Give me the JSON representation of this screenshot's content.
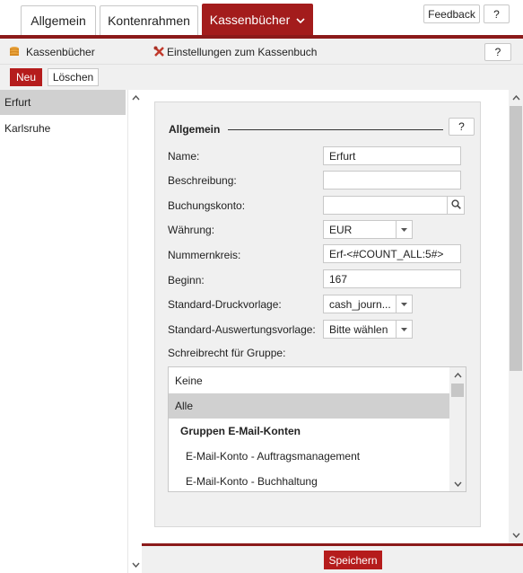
{
  "tabs": [
    {
      "label": "Allgemein"
    },
    {
      "label": "Kontenrahmen"
    },
    {
      "label": "Kassenbücher"
    }
  ],
  "top_buttons": {
    "feedback": "Feedback",
    "help": "?"
  },
  "left_header": {
    "title": "Kassenbücher"
  },
  "right_header": {
    "title": "Einstellungen zum Kassenbuch",
    "help": "?"
  },
  "left_toolbar": {
    "new": "Neu",
    "delete": "Löschen"
  },
  "cashbooks": [
    {
      "label": "Erfurt",
      "selected": true
    },
    {
      "label": "Karlsruhe",
      "selected": false
    }
  ],
  "form": {
    "section_title": "Allgemein",
    "section_help": "?",
    "name": {
      "label": "Name:",
      "value": "Erfurt"
    },
    "description": {
      "label": "Beschreibung:",
      "value": ""
    },
    "account": {
      "label": "Buchungskonto:",
      "value": ""
    },
    "currency": {
      "label": "Währung:",
      "value": "EUR"
    },
    "number_range": {
      "label": "Nummernkreis:",
      "value": "Erf-<#COUNT_ALL:5#>"
    },
    "start": {
      "label": "Beginn:",
      "value": "167"
    },
    "print_template": {
      "label": "Standard-Druckvorlage:",
      "value": "cash_journ..."
    },
    "report_template": {
      "label": "Standard-Auswertungsvorlage:",
      "value": "Bitte wählen"
    },
    "write_group_label": "Schreibrecht für Gruppe:",
    "groups": [
      {
        "label": "Keine",
        "selected": false,
        "bold": false,
        "indent": 0
      },
      {
        "label": "Alle",
        "selected": true,
        "bold": false,
        "indent": 0
      },
      {
        "label": "Gruppen E-Mail-Konten",
        "selected": false,
        "bold": true,
        "indent": 1
      },
      {
        "label": "E-Mail-Konto - Auftragsmanagement",
        "selected": false,
        "bold": false,
        "indent": 2
      },
      {
        "label": "E-Mail-Konto - Buchhaltung",
        "selected": false,
        "bold": false,
        "indent": 2
      }
    ]
  },
  "footer": {
    "save": "Speichern"
  },
  "colors": {
    "accent": "#a31c1c",
    "selection": "#d0d0d0"
  }
}
